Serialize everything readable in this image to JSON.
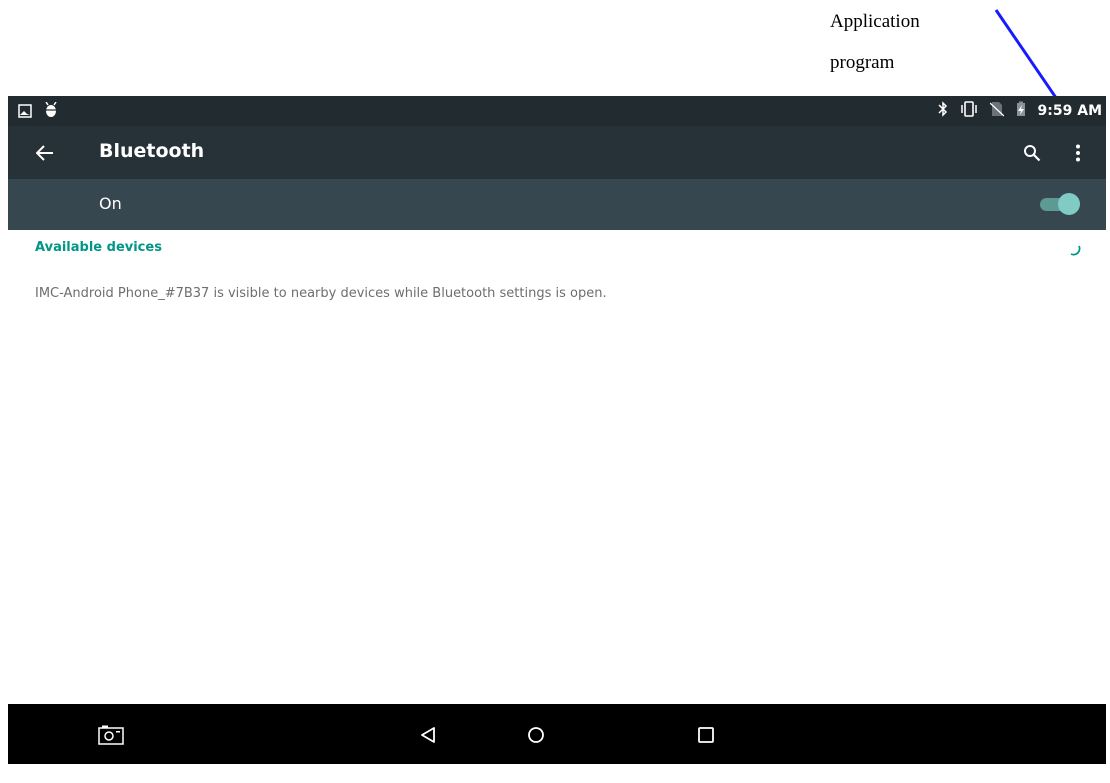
{
  "annotation": {
    "line1": "Application",
    "line2": "program",
    "arrow_color": "#1a1aff"
  },
  "status_bar": {
    "left_icons": [
      "gallery-notification-icon",
      "android-debug-icon"
    ],
    "right_icons": [
      "bluetooth-icon",
      "vibrate-icon",
      "no-sim-icon",
      "battery-charging-icon"
    ],
    "time": "9:59 AM"
  },
  "app_bar": {
    "title": "Bluetooth",
    "back_icon": "arrow-back-icon",
    "search_icon": "search-icon",
    "menu_icon": "more-vert-icon"
  },
  "switch_bar": {
    "label": "On",
    "checked": true
  },
  "content": {
    "section_header": "Available devices",
    "info_text": "IMC-Android Phone_#7B37 is visible to nearby devices while Bluetooth settings is open."
  },
  "nav_bar": {
    "icons": [
      "screenshot-icon",
      "nav-back-icon",
      "nav-home-icon",
      "nav-recents-icon"
    ]
  },
  "colors": {
    "status_bar": "#222b30",
    "app_bar": "#263238",
    "switch_bar": "#37474f",
    "accent": "#009688",
    "toggle_thumb": "#80cbc4"
  }
}
